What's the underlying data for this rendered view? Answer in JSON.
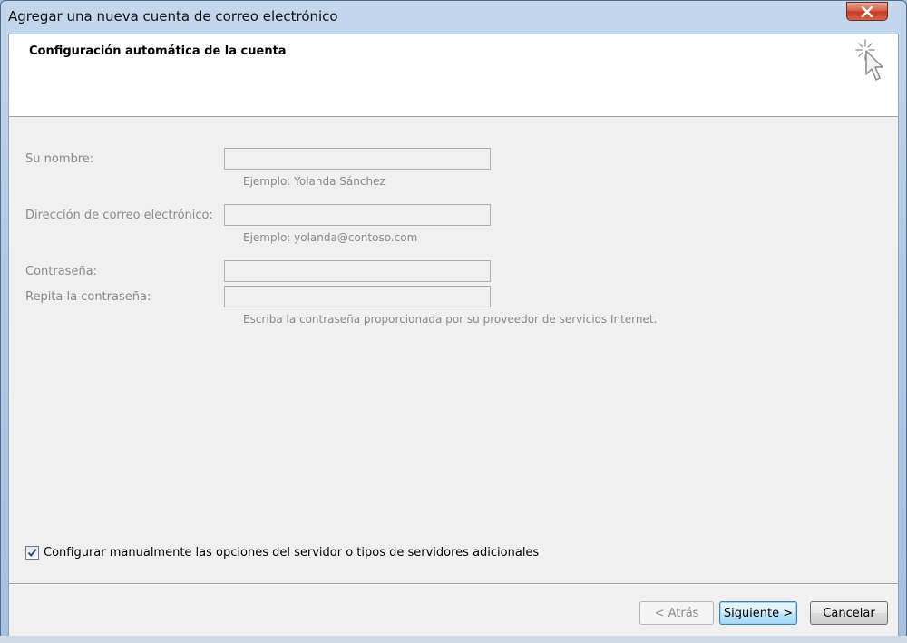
{
  "window": {
    "title": "Agregar una nueva cuenta de correo electrónico"
  },
  "header": {
    "title": "Configuración automática de la cuenta",
    "icon": "wizard-cursor-icon"
  },
  "form": {
    "name": {
      "label": "Su nombre:",
      "value": "",
      "hint": "Ejemplo: Yolanda Sánchez"
    },
    "email": {
      "label": "Dirección de correo electrónico:",
      "value": "",
      "hint": "Ejemplo: yolanda@contoso.com"
    },
    "password": {
      "label": "Contraseña:",
      "value": ""
    },
    "password_repeat": {
      "label": "Repita la contraseña:",
      "value": "",
      "hint": "Escriba la contraseña proporcionada por su proveedor de servicios Internet."
    }
  },
  "manual_config": {
    "label": "Configurar manualmente las opciones del servidor o tipos de servidores adicionales",
    "checked": true
  },
  "buttons": {
    "back": "< Atrás",
    "next": "Siguiente >",
    "cancel": "Cancelar"
  },
  "colors": {
    "disabled_text": "#8a8a8a",
    "close_button": "#c43a1f",
    "default_button_border": "#3c7fb1"
  }
}
